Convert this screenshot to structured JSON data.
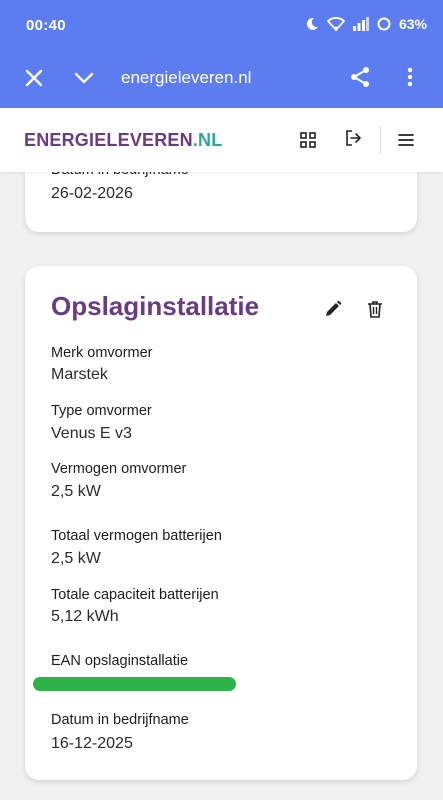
{
  "status_bar": {
    "time": "00:40",
    "battery": "63%"
  },
  "browser": {
    "url": "energieleveren.nl"
  },
  "header": {
    "logo_part1": "ENERGIELEVEREN",
    "logo_part2": ".NL"
  },
  "card_top": {
    "label": "Datum in bedrijfname",
    "value": "26-02-2026"
  },
  "card_main": {
    "title": "Opslaginstallatie",
    "fields": [
      {
        "label": "Merk omvormer",
        "value": "Marstek"
      },
      {
        "label": "Type omvormer",
        "value": "Venus E v3"
      },
      {
        "label": "Vermogen omvormer",
        "value": "2,5 kW"
      },
      {
        "label": "Totaal vermogen batterijen",
        "value": "2,5 kW"
      },
      {
        "label": "Totale capaciteit batterijen",
        "value": "5,12 kWh"
      },
      {
        "label": "EAN opslaginstallatie",
        "value": ""
      },
      {
        "label": "Datum in bedrijfname",
        "value": "16-12-2025"
      }
    ]
  },
  "colors": {
    "brand_bar": "#5b7df0",
    "accent_purple": "#6b3b82",
    "accent_teal": "#2aa8a0",
    "ean_redaction": "#2fb24a"
  }
}
